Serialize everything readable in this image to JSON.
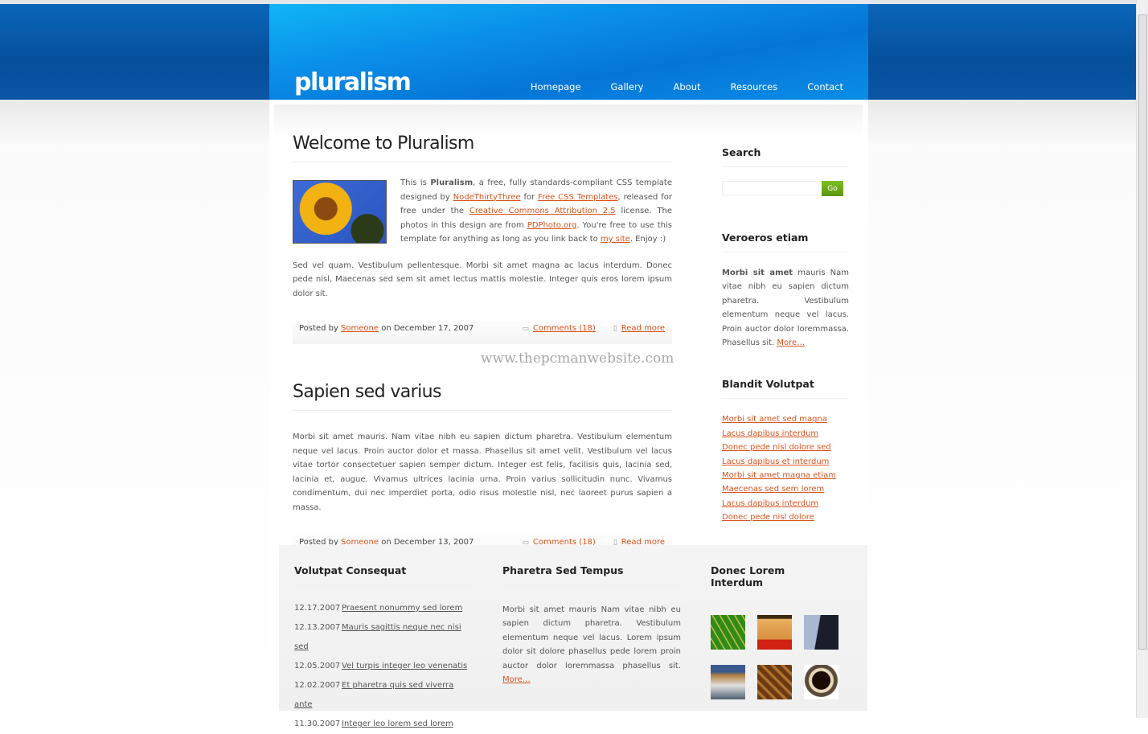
{
  "site": {
    "logo": "pluralism",
    "watermark": "www.thepcmanwebsite.com"
  },
  "nav": [
    "Homepage",
    "Gallery",
    "About",
    "Resources",
    "Contact"
  ],
  "posts": [
    {
      "title": "Welcome to Pluralism",
      "intro": {
        "t1": "This is ",
        "b": "Pluralism",
        "t2": ", a free, fully standards-compliant CSS template designed by ",
        "l1": "NodeThirtyThree",
        "t3": " for ",
        "l2": "Free CSS Templates",
        "t4": ", released for free under the ",
        "l3": "Creative Commons Attribution 2.5",
        "t5": " license. The photos in this design are from ",
        "l4": "PDPhoto.org",
        "t6": ". You're free to use this template for anything as long as you link back to ",
        "l5": "my site",
        "t7": ". Enjoy :)"
      },
      "body": "Sed vel quam. Vestibulum pellentesque. Morbi sit amet magna ac lacus interdum. Donec pede nisl, Maecenas sed sem sit amet lectus mattis molestie. Integer quis eros lorem ipsum dolor sit.",
      "posted_by": "Posted by ",
      "author": "Someone",
      "date": " on December 17, 2007",
      "comments": "Comments (18)",
      "read_more": "Read more"
    },
    {
      "title": "Sapien sed varius",
      "body": "Morbi sit amet mauris. Nam vitae nibh eu sapien dictum pharetra. Vestibulum elementum neque vel lacus. Proin auctor dolor et massa. Phasellus sit amet velit. Vestibulum vel lacus vitae tortor consectetuer sapien semper dictum. Integer est felis, facilisis quis, lacinia sed, lacinia et, augue. Vivamus ultrices lacinia urna. Proin varius sollicitudin nunc. Vivamus condimentum, dui nec imperdiet porta, odio risus molestie nisl, nec laoreet purus sapien a massa.",
      "posted_by": "Posted by ",
      "author": "Someone",
      "date": " on December 13, 2007",
      "comments": "Comments (18)",
      "read_more": "Read more"
    }
  ],
  "sidebar": {
    "search": {
      "title": "Search",
      "value": "",
      "button": "Go"
    },
    "veroeros": {
      "title": "Veroeros etiam",
      "bold": "Morbi sit amet",
      "text": " mauris Nam vitae nibh eu sapien dictum pharetra. Vestibulum elementum neque vel lacus. Proin auctor dolor loremmassa. Phasellus sit. ",
      "more": "More…"
    },
    "blandit": {
      "title": "Blandit Volutpat",
      "links": [
        "Morbi sit amet sed magna",
        "Lacus dapibus interdum",
        "Donec pede nisl dolore sed",
        "Lacus dapibus et interdum",
        "Morbi sit amet magna etiam",
        "Maecenas sed sem lorem",
        "Lacus dapibus interdum",
        "Donec pede nisl dolore"
      ]
    }
  },
  "footer": {
    "col1": {
      "title": "Volutpat Consequat",
      "items": [
        {
          "date": "12.17.2007",
          "link": "Praesent nonummy sed lorem"
        },
        {
          "date": "12.13.2007",
          "link": "Mauris sagittis neque nec nisi sed"
        },
        {
          "date": "12.05.2007",
          "link": "Vel turpis integer leo venenatis"
        },
        {
          "date": "12.02.2007",
          "link": "Et pharetra quis sed viverra ante"
        },
        {
          "date": "11.30.2007",
          "link": "Integer leo lorem sed lorem"
        }
      ]
    },
    "col2": {
      "title": "Pharetra Sed Tempus",
      "text": "Morbi sit amet mauris Nam vitae nibh eu sapien dictum pharetra. Vestibulum elementum neque vel lacus. Lorem ipsum dolor sit dolore phasellus pede lorem proin auctor dolor loremmassa phasellus sit. ",
      "more": "More…"
    },
    "col3": {
      "title": "Donec Lorem Interdum",
      "thumbs": [
        "leaf",
        "cheese",
        "cliff",
        "coast",
        "wood",
        "coffee"
      ]
    }
  },
  "colors": {
    "link": "#d9541e",
    "header_blue": "#0a8ee9",
    "go_button": "#6aa315"
  }
}
